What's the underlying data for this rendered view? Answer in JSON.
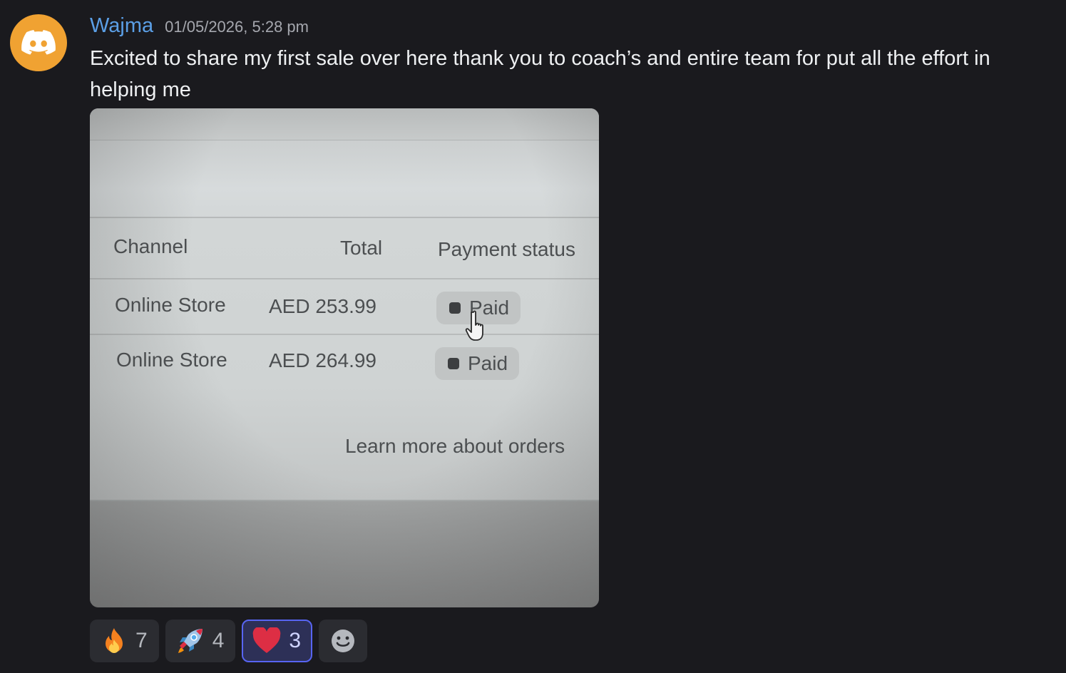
{
  "message": {
    "author": "Wajma",
    "timestamp": "01/05/2026, 5:28 pm",
    "text": "Excited to share my first sale over here thank you to coach’s  and entire team for put all the effort in helping me"
  },
  "photo": {
    "headers": [
      "Channel",
      "Total",
      "Payment status"
    ],
    "rows": [
      {
        "channel": "Online Store",
        "total": "AED 253.99",
        "status": "Paid"
      },
      {
        "channel": "Online Store",
        "total": "AED 264.99",
        "status": "Paid"
      }
    ],
    "footer_link": "Learn more about orders"
  },
  "reactions": [
    {
      "emoji": "fire-emoji",
      "count": "7"
    },
    {
      "emoji": "rocket-emoji",
      "count": "4"
    },
    {
      "emoji": "heart-emoji",
      "count": "3",
      "active": true
    }
  ],
  "colors": {
    "background": "#1a1a1e",
    "username": "#5b9fe6",
    "avatar": "#f0a232",
    "active_reaction_border": "#5865f2"
  }
}
